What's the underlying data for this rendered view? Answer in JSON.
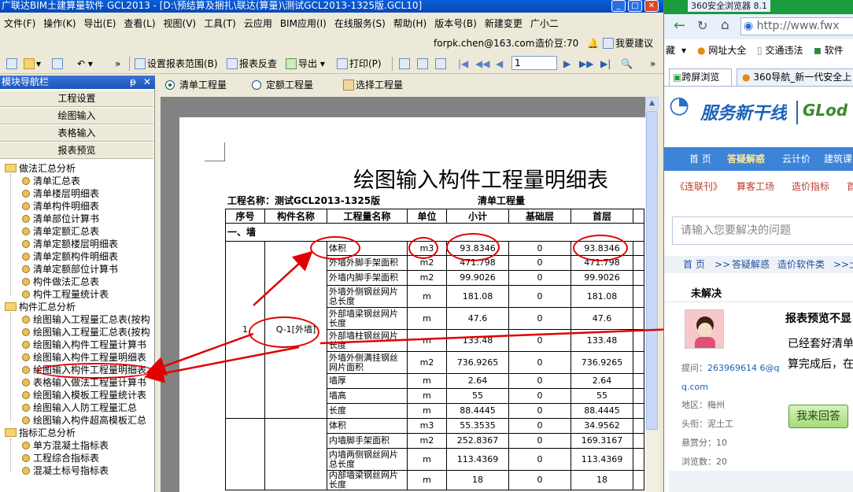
{
  "window": {
    "title": "广联达BIM土建算量软件 GCL2013 - [D:\\预结算及捆扎\\联达(算量)\\测试GCL2013-1325版.GCL10]"
  },
  "menu": [
    "文件(F)",
    "操作(K)",
    "导出(E)",
    "查看(L)",
    "视图(V)",
    "工具(T)",
    "云应用",
    "BIM应用(I)",
    "在线服务(S)",
    "帮助(H)",
    "版本号(B)",
    "新建变更",
    "广小二"
  ],
  "userbar": {
    "email": "forpk.chen@163.com",
    "beans": "造价豆:70",
    "suggest": "我要建议"
  },
  "toolbar": {
    "set_range": "设置报表范围(B)",
    "check": "报表反查",
    "export": "导出",
    "print": "打印(P)",
    "page": "1"
  },
  "nav": {
    "title": "模块导航栏",
    "buttons": [
      "工程设置",
      "绘图输入",
      "表格输入",
      "报表预览"
    ],
    "tree": [
      {
        "type": "folder",
        "label": "做法汇总分析"
      },
      {
        "type": "item",
        "label": "清单汇总表"
      },
      {
        "type": "item",
        "label": "清单楼层明细表"
      },
      {
        "type": "item",
        "label": "清单构件明细表"
      },
      {
        "type": "item",
        "label": "清单部位计算书"
      },
      {
        "type": "item",
        "label": "清单定额汇总表"
      },
      {
        "type": "item",
        "label": "清单定额楼层明细表"
      },
      {
        "type": "item",
        "label": "清单定额构件明细表"
      },
      {
        "type": "item",
        "label": "清单定额部位计算书"
      },
      {
        "type": "item",
        "label": "构件做法汇总表"
      },
      {
        "type": "item",
        "label": "构件工程量统计表"
      },
      {
        "type": "folder",
        "label": "构件汇总分析"
      },
      {
        "type": "item",
        "label": "绘图输入工程量汇总表(按构"
      },
      {
        "type": "item",
        "label": "绘图输入工程量汇总表(按构"
      },
      {
        "type": "item",
        "label": "绘图输入构件工程量计算书"
      },
      {
        "type": "item",
        "label": "绘图输入构件工程量明细表"
      },
      {
        "type": "item",
        "label": "绘图输入构件工程量明细表"
      },
      {
        "type": "item",
        "label": "表格输入做法工程量计算书"
      },
      {
        "type": "item",
        "label": "绘图输入模板工程量统计表"
      },
      {
        "type": "item",
        "label": "绘图输入人防工程量汇总"
      },
      {
        "type": "item",
        "label": "绘图输入构件超高模板汇总"
      },
      {
        "type": "folder",
        "label": "指标汇总分析"
      },
      {
        "type": "item",
        "label": "单方混凝土指标表"
      },
      {
        "type": "item",
        "label": "工程综合指标表"
      },
      {
        "type": "item",
        "label": "混凝土标号指标表"
      }
    ]
  },
  "tabs": {
    "a": "清单工程量",
    "b": "定额工程量",
    "c": "选择工程量"
  },
  "report": {
    "title": "绘图输入构件工程量明细表",
    "project": "工程名称：测试GCL2013-1325版",
    "mode": "清单工程量",
    "headers": [
      "序号",
      "构件名称",
      "工程量名称",
      "单位",
      "小计",
      "基础层",
      "首层"
    ],
    "section": "一、墙",
    "seq": "1",
    "component": "Q-1[外墙]",
    "rows": [
      {
        "name": "体积",
        "unit": "m3",
        "total": "93.8346",
        "base": "0",
        "first": "93.8346"
      },
      {
        "name": "外墙外脚手架面积",
        "unit": "m2",
        "total": "471.798",
        "base": "0",
        "first": "471.798"
      },
      {
        "name": "外墙内脚手架面积",
        "unit": "m2",
        "total": "99.9026",
        "base": "0",
        "first": "99.9026"
      },
      {
        "name": "外墙外侧钢丝网片总长度",
        "unit": "m",
        "total": "181.08",
        "base": "0",
        "first": "181.08"
      },
      {
        "name": "外部墙梁钢丝网片长度",
        "unit": "m",
        "total": "47.6",
        "base": "0",
        "first": "47.6"
      },
      {
        "name": "外部墙柱钢丝网片长度",
        "unit": "m",
        "total": "133.48",
        "base": "0",
        "first": "133.48"
      },
      {
        "name": "外墙外侧满挂钢丝网片面积",
        "unit": "m2",
        "total": "736.9265",
        "base": "0",
        "first": "736.9265"
      },
      {
        "name": "墙厚",
        "unit": "m",
        "total": "2.64",
        "base": "0",
        "first": "2.64"
      },
      {
        "name": "墙高",
        "unit": "m",
        "total": "55",
        "base": "0",
        "first": "55"
      },
      {
        "name": "长度",
        "unit": "m",
        "total": "88.4445",
        "base": "0",
        "first": "88.4445"
      },
      {
        "name": "体积",
        "unit": "m3",
        "total": "55.3535",
        "base": "0",
        "first": "34.9562"
      },
      {
        "name": "内墙脚手架面积",
        "unit": "m2",
        "total": "252.8367",
        "base": "0",
        "first": "169.3167"
      },
      {
        "name": "内墙两侧钢丝网片总长度",
        "unit": "m",
        "total": "113.4369",
        "base": "0",
        "first": "113.4369"
      },
      {
        "name": "内部墙梁钢丝网片长度",
        "unit": "m",
        "total": "18",
        "base": "0",
        "first": "18"
      }
    ]
  },
  "browser": {
    "app_name": "360安全浏览器 8.1",
    "url": "http://www.fwx",
    "bookmarks": [
      "藏",
      "网址大全",
      "交通违法",
      "软件"
    ],
    "tabs": [
      "跨屏浏览",
      "360导航_新一代安全上"
    ],
    "logo_cn": "服务新干线",
    "logo_en": "GLod",
    "nav": [
      "首 页",
      "答疑解惑",
      "云计价",
      "建筑课"
    ],
    "subnav": [
      "《连联刊》",
      "算客工场",
      "造价指标",
      "首"
    ],
    "search_placeholder": "请输入您要解决的问题",
    "crumb": [
      "首 页",
      ">>",
      "答疑解惑",
      "造价软件类",
      ">>",
      "土"
    ],
    "status": "未解决",
    "question_title": "报表预览不显",
    "question_text": [
      "已经套好清单",
      "算完成后，在"
    ],
    "asker": {
      "label": "提问：",
      "name": "263969614 6@q",
      "name2": "q.com"
    },
    "region": "地区：梅州",
    "rank": "头衔：泥土工",
    "reward": "悬赏分：10",
    "views": "浏览数：20",
    "answer_btn": "我来回答"
  }
}
